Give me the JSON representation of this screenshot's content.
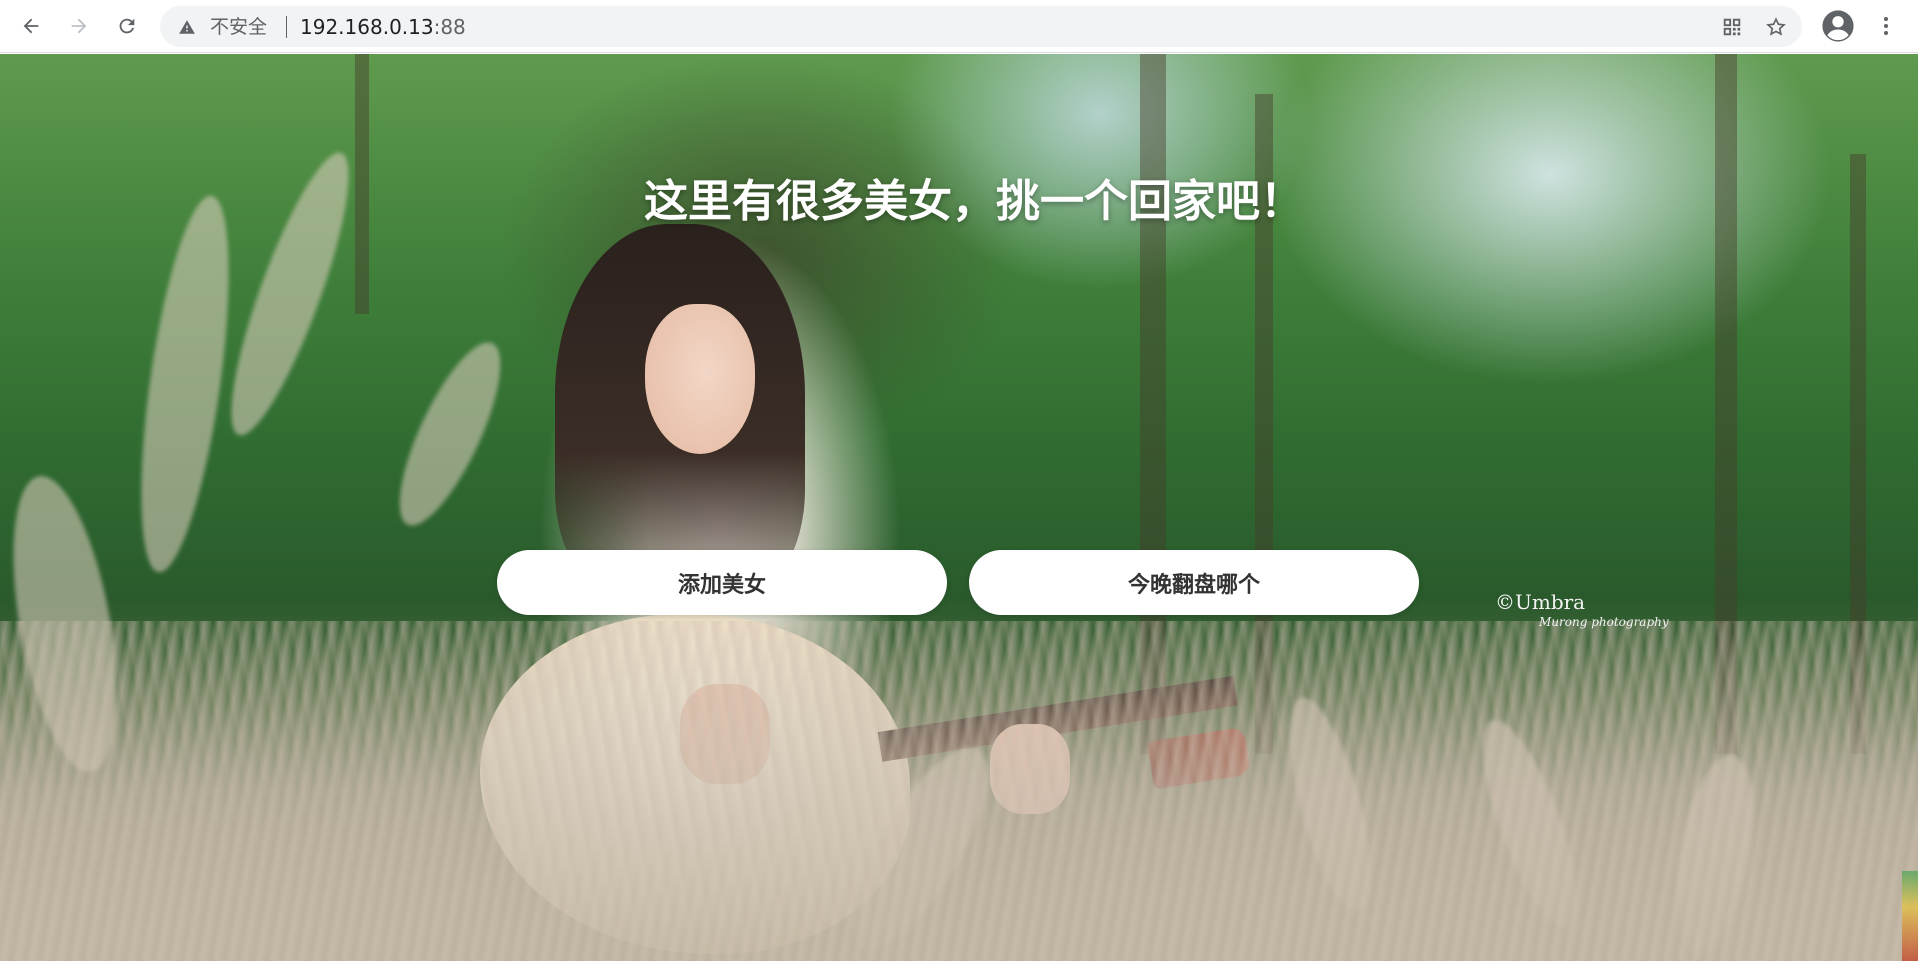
{
  "browser": {
    "security_label": "不安全",
    "url_host": "192.168.0.13",
    "url_port": ":88"
  },
  "icons": {
    "back": "back-arrow-icon",
    "forward": "forward-arrow-icon",
    "reload": "reload-icon",
    "warning": "warning-triangle-icon",
    "qr": "qr-code-icon",
    "bookmark": "star-icon",
    "profile": "account-icon",
    "menu": "more-vertical-icon"
  },
  "hero": {
    "title": "这里有很多美女，挑一个回家吧！"
  },
  "actions": {
    "add_label": "添加美女",
    "pick_label": "今晚翻盘哪个"
  },
  "watermark": {
    "main": "©Umbra",
    "sub": "Murong photography"
  },
  "colors": {
    "button_bg": "#ffffff",
    "button_text": "#333333",
    "title_text": "#ffffff"
  }
}
